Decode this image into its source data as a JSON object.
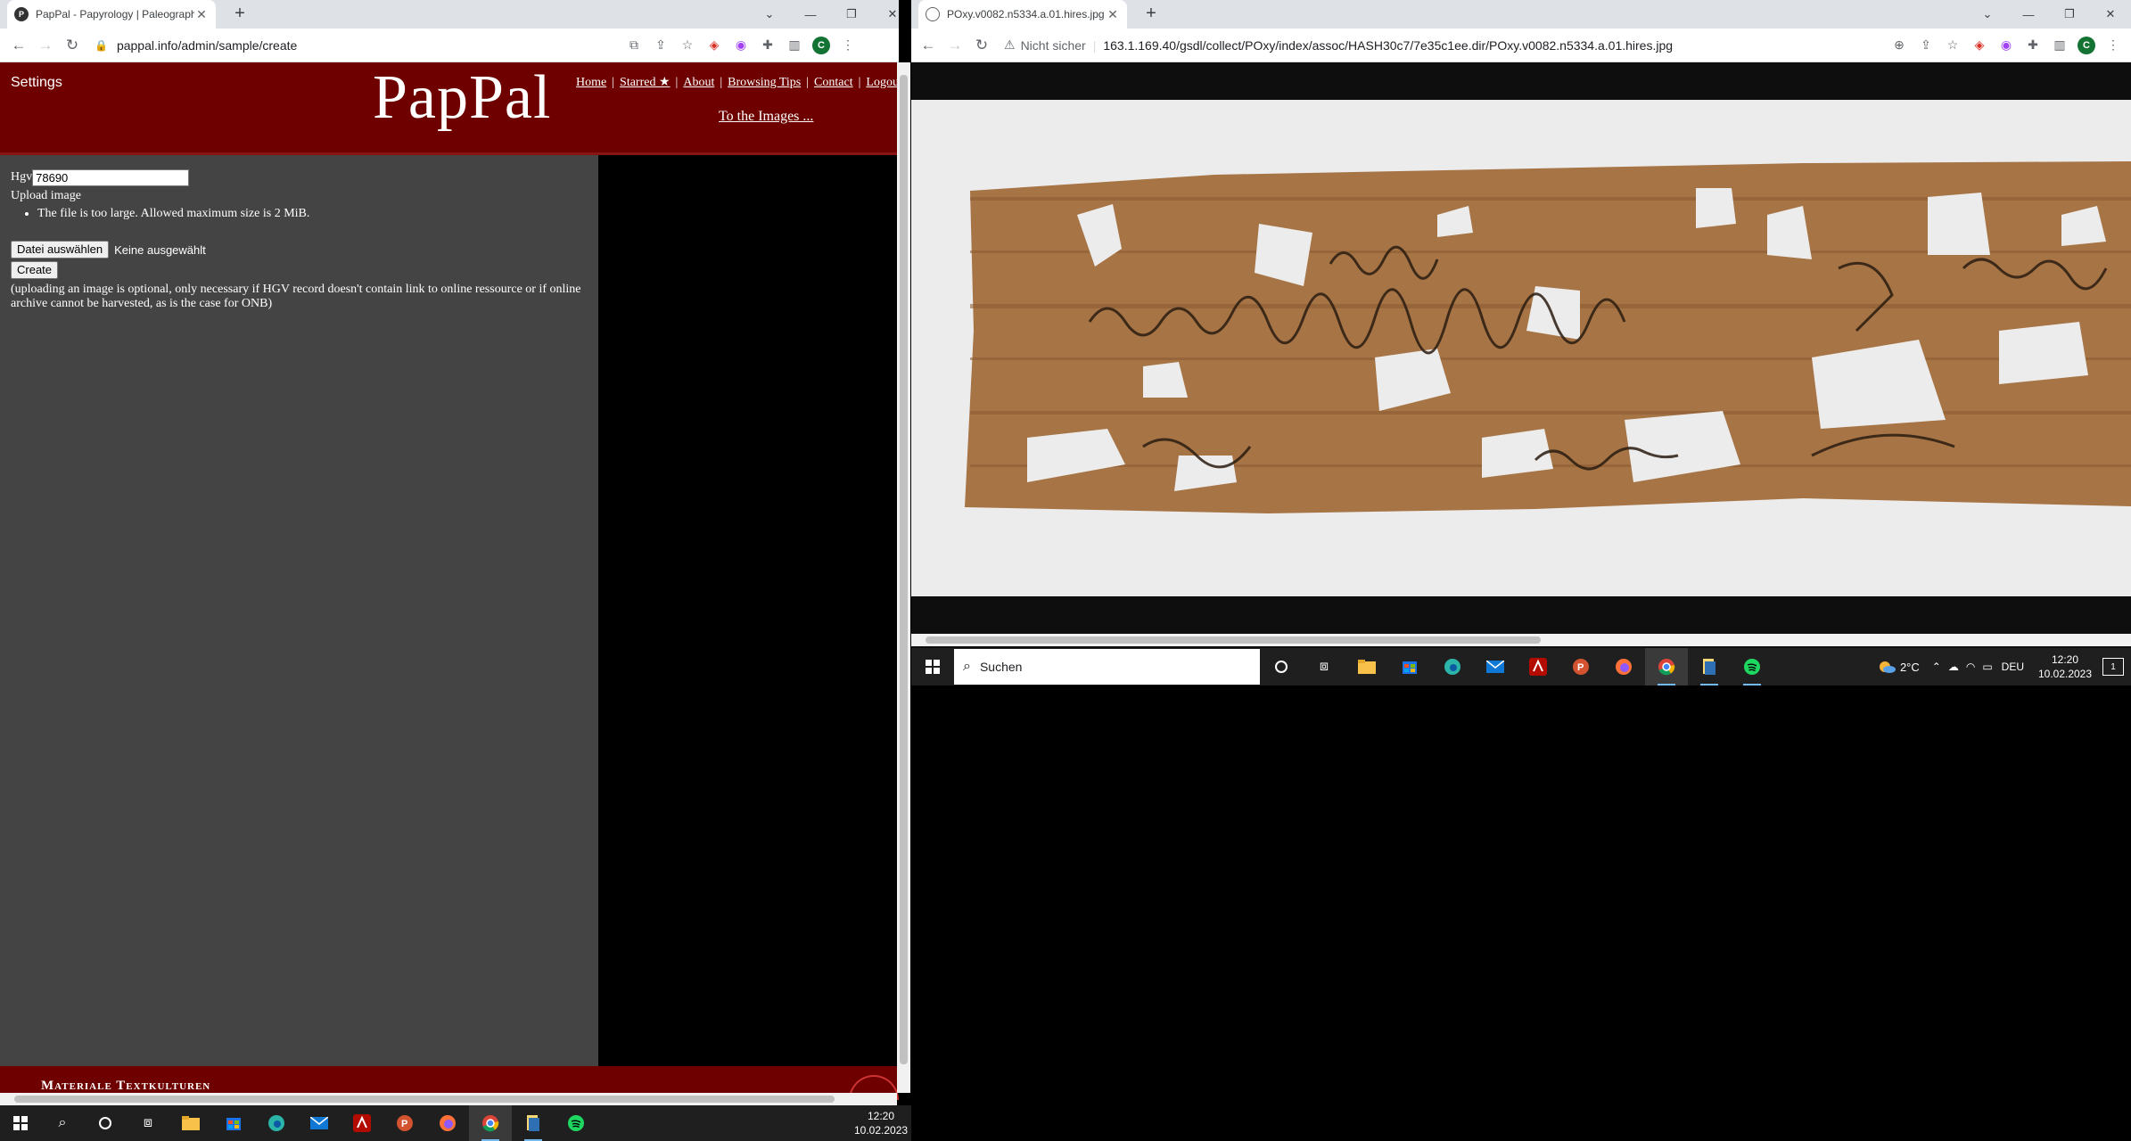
{
  "left_window": {
    "tab": {
      "title": "PapPal - Papyrology | Paleograph",
      "favicon": "pappal-favicon"
    },
    "url": "pappal.info/admin/sample/create",
    "page": {
      "settings": "Settings",
      "logo": "PapPal",
      "nav": [
        "Home",
        "Starred ★",
        "About",
        "Browsing Tips",
        "Contact",
        "Logout"
      ],
      "to_images": "To the Images ...",
      "form": {
        "hgv_label": "Hgv",
        "hgv_value": "78690",
        "upload_label": "Upload image",
        "error": "The file is too large. Allowed maximum size is 2 MiB.",
        "choose_file": "Datei auswählen",
        "no_file": "Keine ausgewählt",
        "create": "Create",
        "note": "(uploading an image is optional, only necessary if HGV record doesn't contain link to online ressource or if online archive cannot be harvested, as is the case for ONB)"
      },
      "footer": "Materiale Textkulturen"
    },
    "taskbar_clock": {
      "time": "12:20",
      "date": "10.02.2023"
    }
  },
  "right_window": {
    "tab": {
      "title": "POxy.v0082.n5334.a.01.hires.jpg",
      "favicon": "globe-icon"
    },
    "security": "Nicht sicher",
    "url": "163.1.169.40/gsdl/collect/POxy/index/assoc/HASH30c7/7e35c1ee.dir/POxy.v0082.n5334.a.01.hires.jpg",
    "taskbar": {
      "search_placeholder": "Suchen",
      "weather": "2°C",
      "language": "DEU",
      "time": "12:20",
      "date": "10.02.2023",
      "notifications": "1"
    }
  },
  "colors": {
    "pappal_red": "#6e0000",
    "page_bg": "#444444",
    "papyrus": "#a77446"
  }
}
